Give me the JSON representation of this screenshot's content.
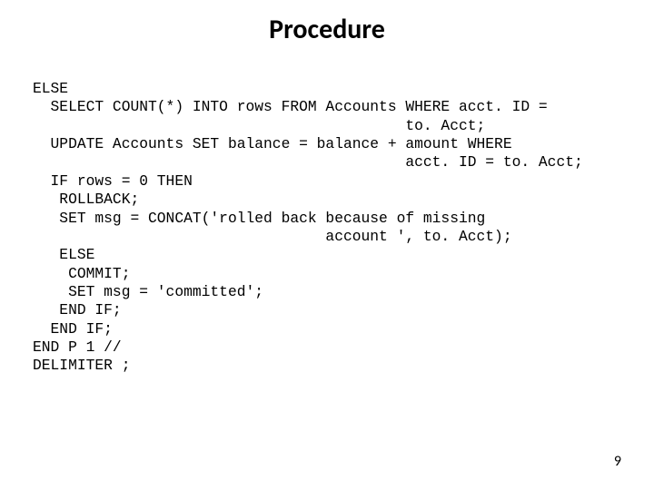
{
  "title": "Procedure",
  "page_number": "9",
  "code": {
    "l01": "ELSE",
    "l02": "  SELECT COUNT(*) INTO rows FROM Accounts WHERE acct. ID =",
    "l03": "                                          to. Acct;",
    "l04": "  UPDATE Accounts SET balance = balance + amount WHERE",
    "l05": "                                          acct. ID = to. Acct;",
    "l06": "  IF rows = 0 THEN",
    "l07": "   ROLLBACK;",
    "l08": "   SET msg = CONCAT('rolled back because of missing",
    "l09": "                                 account ', to. Acct);",
    "l10": "   ELSE",
    "l11": "    COMMIT;",
    "l12": "    SET msg = 'committed';",
    "l13": "   END IF;",
    "l14": "  END IF;",
    "l15": "END P 1 //",
    "l16": "DELIMITER ;"
  }
}
